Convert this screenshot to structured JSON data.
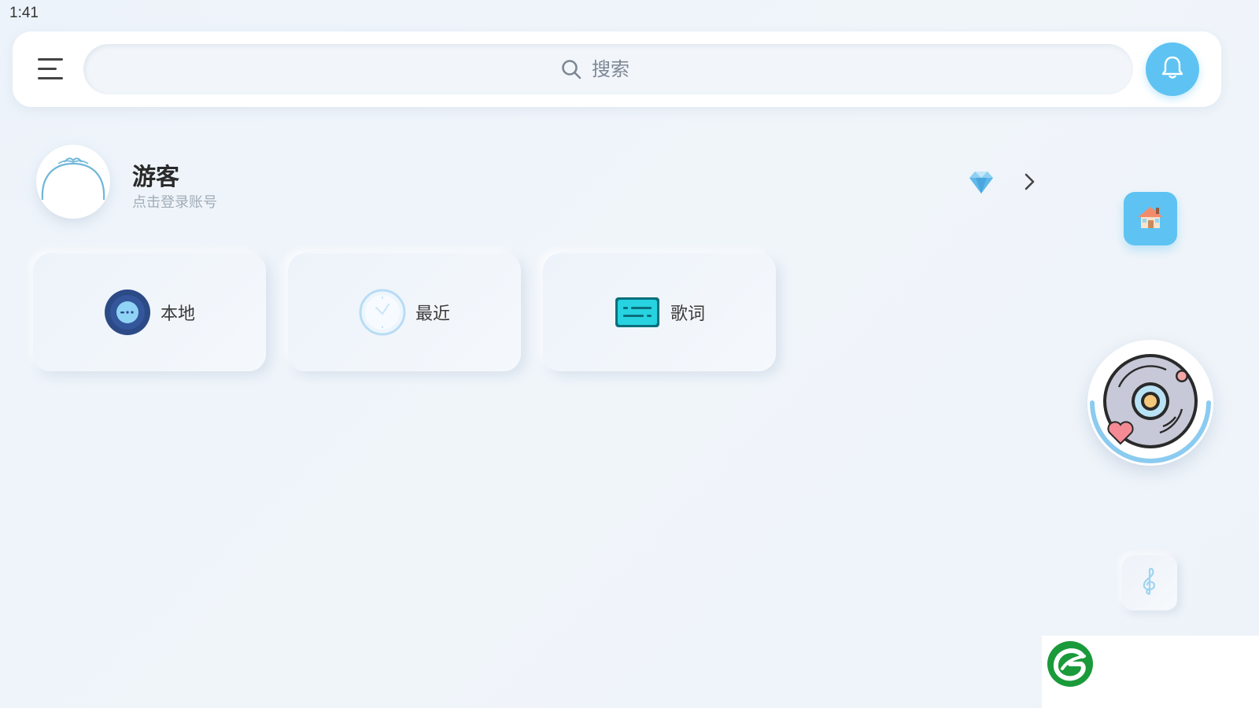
{
  "status_bar": {
    "time": "1:41"
  },
  "header": {
    "menu_icon": "hamburger-menu-icon",
    "search": {
      "placeholder": "搜索",
      "value": "",
      "icon": "search-icon"
    },
    "notification_icon": "bell-icon"
  },
  "profile": {
    "name": "游客",
    "subtitle": "点击登录账号",
    "vip_icon": "diamond-icon",
    "arrow_icon": "chevron-right-icon"
  },
  "quick_access": [
    {
      "label": "本地",
      "icon": "vinyl-disc-icon"
    },
    {
      "label": "最近",
      "icon": "clock-icon"
    },
    {
      "label": "歌词",
      "icon": "lyrics-card-icon"
    }
  ],
  "side_actions": {
    "home_icon": "home-icon",
    "player_icon": "vinyl-player-icon",
    "music_icon": "treble-clef-icon"
  },
  "colors": {
    "accent": "#5ec3f2",
    "background": "#eef3f9",
    "card": "#f2f6fb",
    "text_primary": "#2a2a2a",
    "text_secondary": "#a3acb7",
    "logo_green": "#1a9a3a"
  }
}
